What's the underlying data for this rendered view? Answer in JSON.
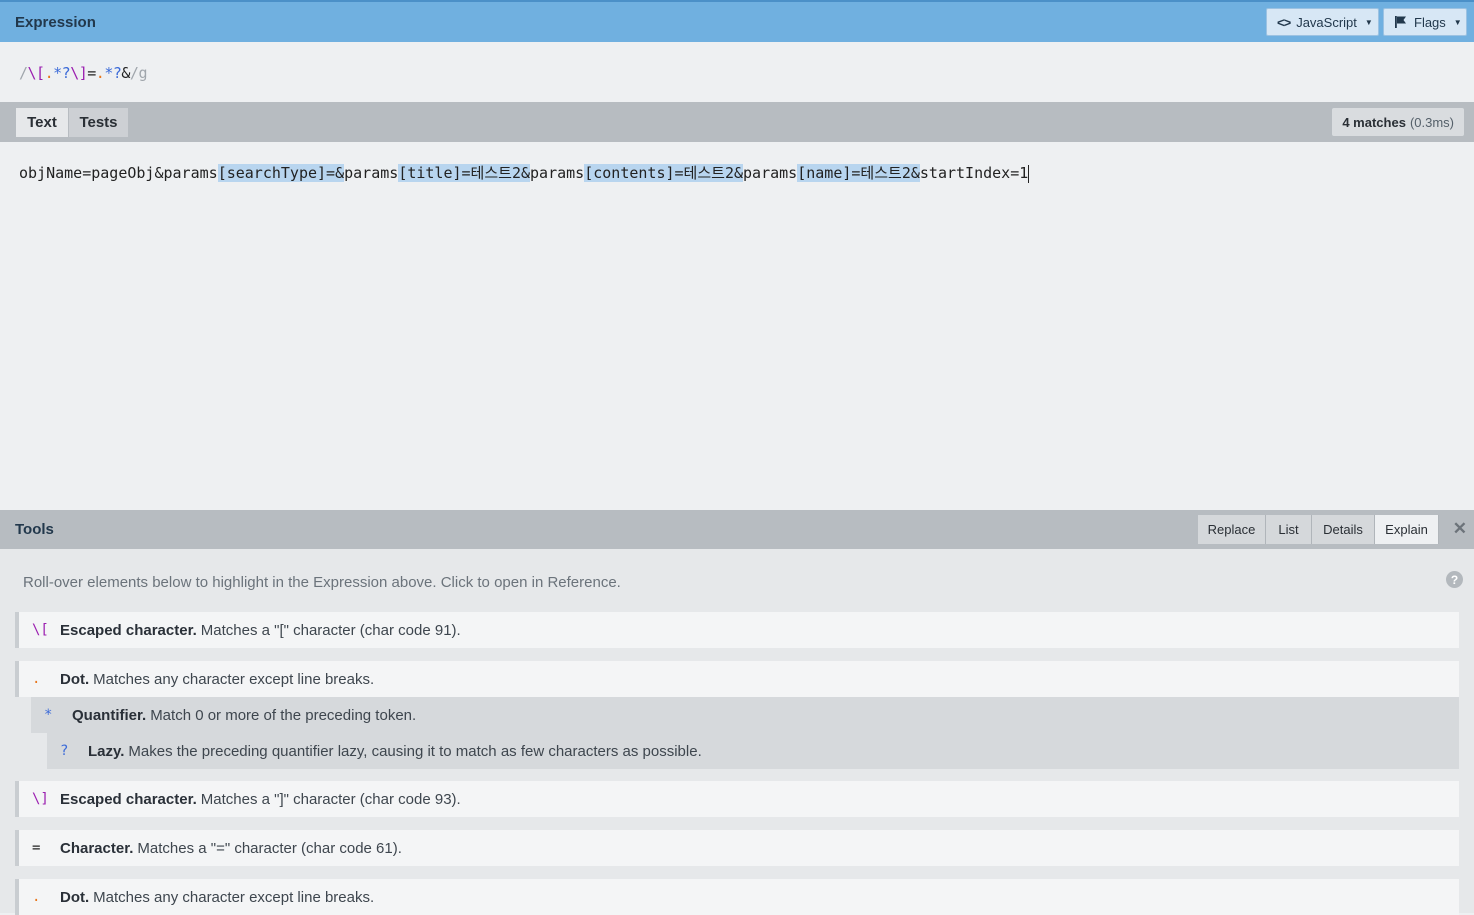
{
  "header": {
    "title": "Expression",
    "flavor_label": "JavaScript",
    "flags_label": "Flags"
  },
  "expression": {
    "delim_open": "/",
    "tokens": [
      {
        "text": "\\[",
        "color": "#9b1fb0"
      },
      {
        "text": ".",
        "color": "#e8761c"
      },
      {
        "text": "*?",
        "color": "#3c6bd8"
      },
      {
        "text": "\\]",
        "color": "#9b1fb0"
      },
      {
        "text": "=",
        "color": "#222222"
      },
      {
        "text": ".",
        "color": "#e8761c"
      },
      {
        "text": "*?",
        "color": "#3c6bd8"
      },
      {
        "text": "&",
        "color": "#222222"
      }
    ],
    "delim_close": "/",
    "flags": "g"
  },
  "tabs": {
    "text_label": "Text",
    "tests_label": "Tests",
    "matches_label": "4 matches",
    "matches_time": "(0.3ms)"
  },
  "text_content": {
    "segments": [
      {
        "text": "objName=pageObj&params",
        "match": false
      },
      {
        "text": "[searchType]=&",
        "match": true
      },
      {
        "text": "params",
        "match": false
      },
      {
        "text": "[title]=테스트2&",
        "match": true
      },
      {
        "text": "params",
        "match": false
      },
      {
        "text": "[contents]=테스트2&",
        "match": true
      },
      {
        "text": "params",
        "match": false
      },
      {
        "text": "[name]=테스트2&",
        "match": true
      },
      {
        "text": "startIndex=1",
        "match": false
      }
    ]
  },
  "tools": {
    "title": "Tools",
    "tabs": [
      "Replace",
      "List",
      "Details",
      "Explain"
    ],
    "active_tab": "Explain"
  },
  "explain": {
    "note": "Roll-over elements below to highlight in the Expression above. Click to open in Reference.",
    "rows": [
      {
        "token": "\\[",
        "token_color": "#9b1fb0",
        "label": "Escaped character.",
        "desc": "Matches a \"[\" character (char code 91).",
        "indent": 0
      },
      {
        "token": ".",
        "token_color": "#e8761c",
        "label": "Dot.",
        "desc": "Matches any character except line breaks.",
        "indent": 0
      },
      {
        "token": "*",
        "token_color": "#3c6bd8",
        "label": "Quantifier.",
        "desc": "Match 0 or more of the preceding token.",
        "indent": 1
      },
      {
        "token": "?",
        "token_color": "#3c6bd8",
        "label": "Lazy.",
        "desc": "Makes the preceding quantifier lazy, causing it to match as few characters as possible.",
        "indent": 2
      },
      {
        "token": "\\]",
        "token_color": "#9b1fb0",
        "label": "Escaped character.",
        "desc": "Matches a \"]\" character (char code 93).",
        "indent": 0
      },
      {
        "token": "=",
        "token_color": "#222222",
        "label": "Character.",
        "desc": "Matches a \"=\" character (char code 61).",
        "indent": 0
      },
      {
        "token": ".",
        "token_color": "#e8761c",
        "label": "Dot.",
        "desc": "Matches any character except line breaks.",
        "indent": 0
      }
    ]
  }
}
